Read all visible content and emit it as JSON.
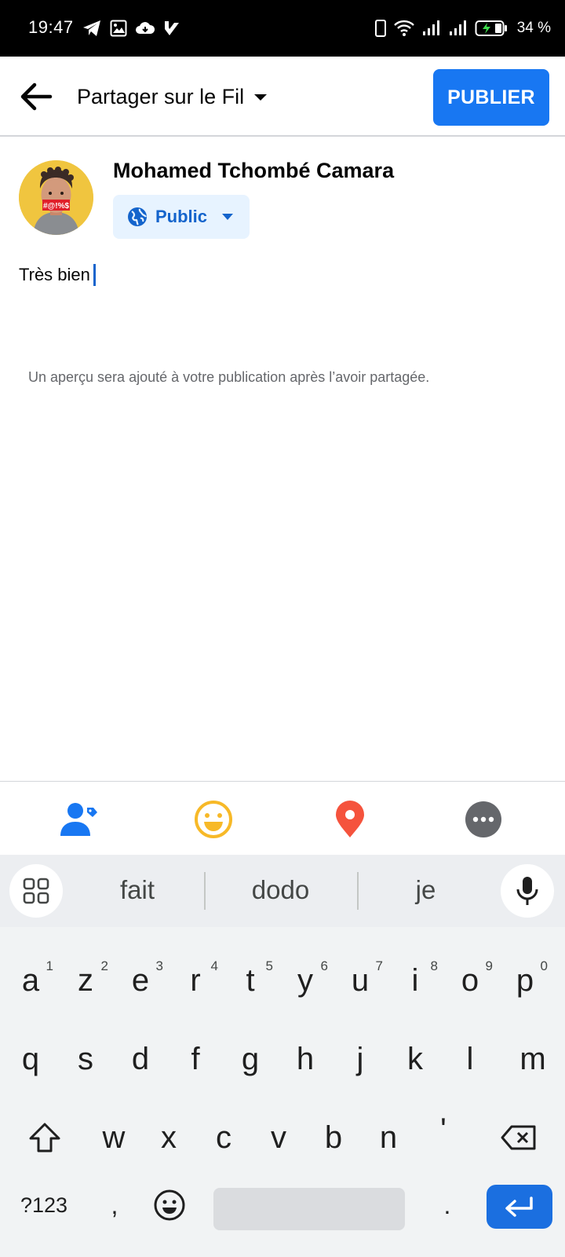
{
  "status_bar": {
    "time": "19:47",
    "battery_text": "34 %",
    "icons_left": [
      "telegram-icon",
      "image-icon",
      "cloud-download-icon",
      "checklist-icon"
    ],
    "icons_right": [
      "phone-icon",
      "wifi-icon",
      "signal-icon",
      "signal-icon",
      "battery-charging-icon"
    ]
  },
  "header": {
    "title": "Partager sur le Fil",
    "publish_label": "PUBLIER"
  },
  "author": {
    "name": "Mohamed Tchombé Camara",
    "privacy_label": "Public"
  },
  "composer": {
    "text": "Très bien",
    "preview_note": "Un aperçu sera ajouté à votre publication après l’avoir partagée."
  },
  "toolbar": {
    "tools": [
      "tag-people-icon",
      "feeling-icon",
      "location-icon",
      "more-icon"
    ]
  },
  "keyboard": {
    "suggestions": [
      "fait",
      "dodo",
      "je"
    ],
    "row1": [
      {
        "key": "a",
        "hint": "1"
      },
      {
        "key": "z",
        "hint": "2"
      },
      {
        "key": "e",
        "hint": "3"
      },
      {
        "key": "r",
        "hint": "4"
      },
      {
        "key": "t",
        "hint": "5"
      },
      {
        "key": "y",
        "hint": "6"
      },
      {
        "key": "u",
        "hint": "7"
      },
      {
        "key": "i",
        "hint": "8"
      },
      {
        "key": "o",
        "hint": "9"
      },
      {
        "key": "p",
        "hint": "0"
      }
    ],
    "row2": [
      "q",
      "s",
      "d",
      "f",
      "g",
      "h",
      "j",
      "k",
      "l",
      "m"
    ],
    "row3": [
      "w",
      "x",
      "c",
      "v",
      "b",
      "n",
      "'"
    ],
    "symbols_label": "?123",
    "comma": ",",
    "period": "."
  },
  "colors": {
    "accent": "#1877f2",
    "privacy_bg": "#e7f3ff",
    "location": "#f5533d",
    "feeling": "#f7b928"
  }
}
